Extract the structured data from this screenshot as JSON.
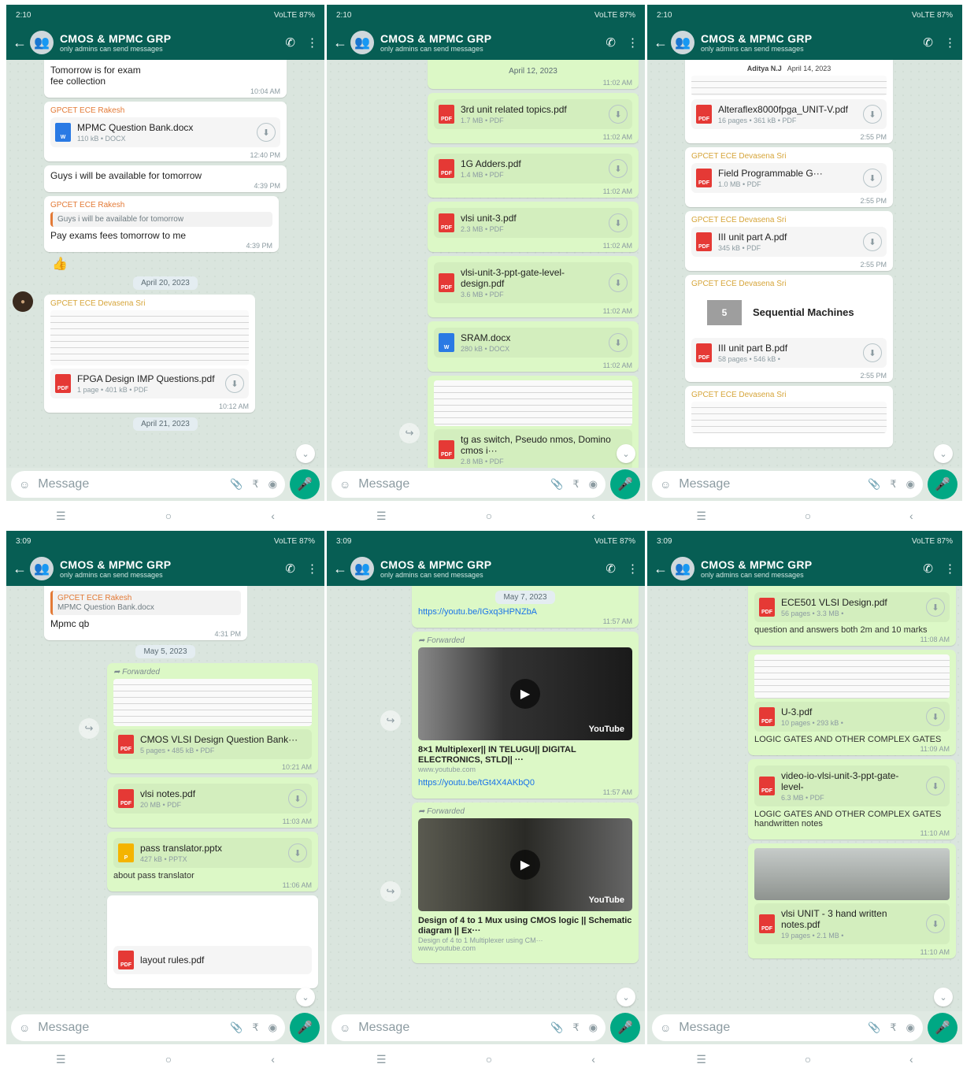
{
  "common": {
    "group_name": "CMOS & MPMC GRP",
    "group_sub": "only admins can send messages",
    "message_placeholder": "Message",
    "status_right": "VoLTE 87%"
  },
  "p1": {
    "status_time": "2:10",
    "top_text": "Tomorrow is",
    "top_text2": "for exam",
    "top_sub": "fee collection",
    "top_time": "10:04 AM",
    "m1_sender": "GPCET ECE Rakesh",
    "m1_doc_name": "MPMC Question Bank.docx",
    "m1_doc_meta": "110 kB • DOCX",
    "m1_time": "12:40 PM",
    "m2_text": "Guys i will be available for tomorrow",
    "m2_time": "4:39 PM",
    "m3_sender": "GPCET ECE Rakesh",
    "m3_quote": "Guys i will be available for tomorrow",
    "m3_text": "Pay exams fees tomorrow  to me",
    "m3_time": "4:39 PM",
    "emoji": "👍",
    "date1": "April 20, 2023",
    "m4_sender": "GPCET ECE Devasena Sri",
    "m4_doc_name": "FPGA Design IMP Questions.pdf",
    "m4_doc_meta": "1 page • 401 kB • PDF",
    "m4_time": "10:12 AM",
    "date2": "April 21, 2023"
  },
  "p2": {
    "status_time": "2:10",
    "date1": "April 12, 2023",
    "top_time": "11:02 AM",
    "d1_name": "3rd unit related topics.pdf",
    "d1_meta": "1.7 MB • PDF",
    "d1_time": "11:02 AM",
    "d2_name": "1G Adders.pdf",
    "d2_meta": "1.4 MB • PDF",
    "d2_time": "11:02 AM",
    "d3_name": "vlsi unit-3.pdf",
    "d3_meta": "2.3 MB • PDF",
    "d3_time": "11:02 AM",
    "d4_name": "vlsi-unit-3-ppt-gate-level-design.pdf",
    "d4_meta": "3.6 MB • PDF",
    "d4_time": "11:02 AM",
    "d5_name": "SRAM.docx",
    "d5_meta": "280 kB • DOCX",
    "d5_time": "11:02 AM",
    "d6_name": "tg as switch, Pseudo nmos, Domino cmos i···",
    "d6_meta": "2.8 MB • PDF"
  },
  "p3": {
    "status_time": "2:10",
    "top_sender": "Aditya N.J",
    "top_date": "April 14, 2023",
    "d1_name": "Alteraflex8000fpga_UNIT-V.pdf",
    "d1_meta": "16 pages • 361 kB • PDF",
    "d1_time": "2:55 PM",
    "m2_sender": "GPCET ECE Devasena Sri",
    "d2_name": "Field Programmable G···",
    "d2_meta": "1.0 MB • PDF",
    "d2_time": "2:55 PM",
    "m3_sender": "GPCET ECE Devasena Sri",
    "d3_name": "III unit part A.pdf",
    "d3_meta": "345 kB • PDF",
    "d3_time": "2:55 PM",
    "m4_sender": "GPCET ECE Devasena Sri",
    "seq_label": "5",
    "seq_title": "Sequential Machines",
    "d4_name": "III unit part B.pdf",
    "d4_meta": "58 pages • 546 kB •",
    "d4_time": "2:55 PM",
    "m5_sender": "GPCET ECE Devasena Sri"
  },
  "p4": {
    "status_time": "3:09",
    "top_sender": "GPCET ECE Rakesh",
    "top_quote": "MPMC Question Bank.docx",
    "top_text": "Mpmc qb",
    "top_time": "4:31 PM",
    "date1": "May 5, 2023",
    "fwd1": "Forwarded",
    "d1_name": "CMOS VLSI Design Question Bank···",
    "d1_meta": "5 pages • 485 kB • PDF",
    "d1_time": "10:21 AM",
    "d2_name": "vlsi notes.pdf",
    "d2_meta": "20 MB • PDF",
    "d2_time": "11:03 AM",
    "d3_name": "pass translator.pptx",
    "d3_meta": "427 kB • PPTX",
    "d3_caption": "about pass translator",
    "d3_time": "11:06 AM",
    "d4_name": "layout rules.pdf"
  },
  "p5": {
    "status_time": "3:09",
    "top_date": "May 7, 2023",
    "link1": "https://youtu.be/IGxq3HPNZbA",
    "link1_time": "11:57 AM",
    "fwd1": "Forwarded",
    "yt_label": "YouTube",
    "v1_title": "8×1 Multiplexer|| IN TELUGU|| DIGITAL ELECTRONICS, STLD|| ···",
    "v1_site": "www.youtube.com",
    "link2": "https://youtu.be/tGt4X4AKbQ0",
    "link2_time": "11:57 AM",
    "fwd2": "Forwarded",
    "v2_title": "Design of 4 to 1 Mux using CMOS logic || Schematic diagram || Ex···",
    "v2_sub": "Design of 4 to 1 Multiplexer using CM···",
    "v2_site": "www.youtube.com"
  },
  "p6": {
    "status_time": "3:09",
    "d1_name": "ECE501 VLSI Design.pdf",
    "d1_meta": "56 pages • 3.3 MB •",
    "d1_caption": "question and answers both 2m and 10 marks",
    "d1_time": "11:08 AM",
    "d2_name": "U-3.pdf",
    "d2_meta": "10 pages • 293 kB •",
    "d2_caption": "LOGIC GATES AND OTHER COMPLEX GATES",
    "d2_time": "11:09 AM",
    "d3_name": "video-io-vlsi-unit-3-ppt-gate-level-",
    "d3_meta": "6.3 MB • PDF",
    "d3_caption": "LOGIC GATES AND OTHER COMPLEX GATES  handwritten notes",
    "d3_time": "11:10 AM",
    "d4_name": "vlsi UNIT - 3 hand written  notes.pdf",
    "d4_meta": "19 pages • 2.1 MB •",
    "d4_time": "11:10 AM"
  }
}
